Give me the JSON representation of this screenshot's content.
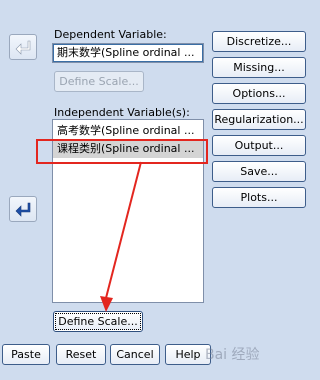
{
  "dependent": {
    "label": "Dependent Variable:",
    "value": "期末数学(Spline ordinal ...",
    "define_scale": "Define Scale..."
  },
  "independent": {
    "label": "Independent Variable(s):",
    "items": [
      {
        "label": "高考数学(Spline ordinal ..."
      },
      {
        "label": "课程类别(Spline ordinal ..."
      }
    ],
    "define_scale": "Define Scale..."
  },
  "side_buttons": [
    {
      "label": "Discretize..."
    },
    {
      "label": "Missing..."
    },
    {
      "label": "Options..."
    },
    {
      "label": "Regularization..."
    },
    {
      "label": "Output..."
    },
    {
      "label": "Save..."
    },
    {
      "label": "Plots..."
    }
  ],
  "bottom_buttons": [
    {
      "label": "Paste"
    },
    {
      "label": "Reset"
    },
    {
      "label": "Cancel"
    },
    {
      "label": "Help"
    }
  ],
  "icons": {
    "move_dependent": "arrow-left-icon",
    "move_independent": "arrow-left-icon"
  },
  "watermark": "Bai 经验",
  "colors": {
    "background": "#cfdcee",
    "annotation": "#e3261f",
    "arrow_blue": "#1e4fa8"
  }
}
